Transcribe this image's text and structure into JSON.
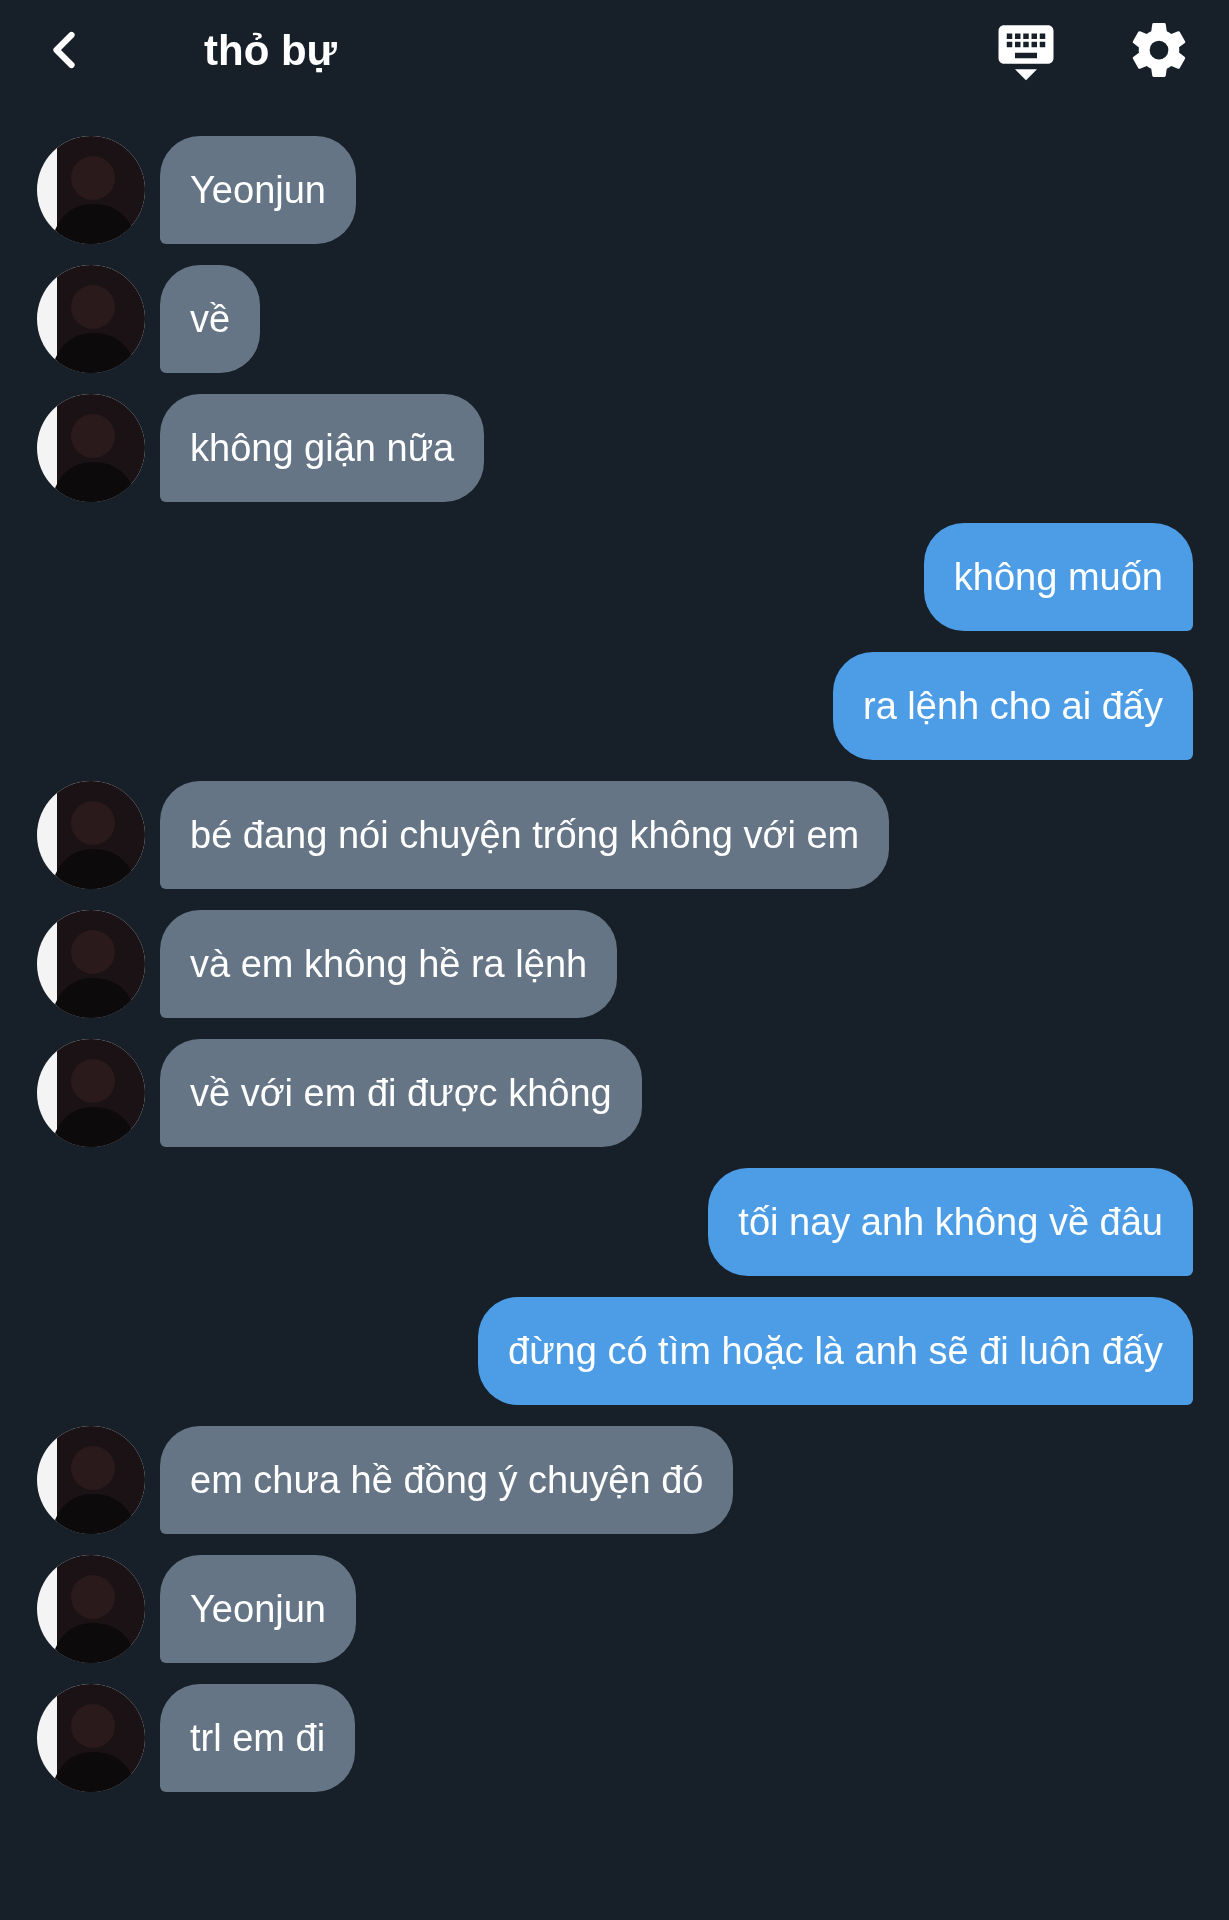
{
  "header": {
    "title": "thỏ bự"
  },
  "messages": [
    {
      "kind": "received",
      "text": "Yeonjun"
    },
    {
      "kind": "received",
      "text": "về"
    },
    {
      "kind": "received",
      "text": "không giận nữa"
    },
    {
      "kind": "sent",
      "text": "không muốn"
    },
    {
      "kind": "sent",
      "text": "ra lệnh cho ai đấy"
    },
    {
      "kind": "received",
      "text": "bé đang nói chuyện trống không với em"
    },
    {
      "kind": "received",
      "text": "và em không hề ra lệnh"
    },
    {
      "kind": "received",
      "text": "về với em đi được không"
    },
    {
      "kind": "sent",
      "text": "tối nay anh không về đâu"
    },
    {
      "kind": "sent",
      "text": "đừng có tìm hoặc là anh sẽ đi luôn đấy"
    },
    {
      "kind": "received",
      "text": "em chưa hề đồng ý chuyện đó"
    },
    {
      "kind": "received",
      "text": "Yeonjun"
    },
    {
      "kind": "received",
      "text": "trl em đi"
    }
  ]
}
